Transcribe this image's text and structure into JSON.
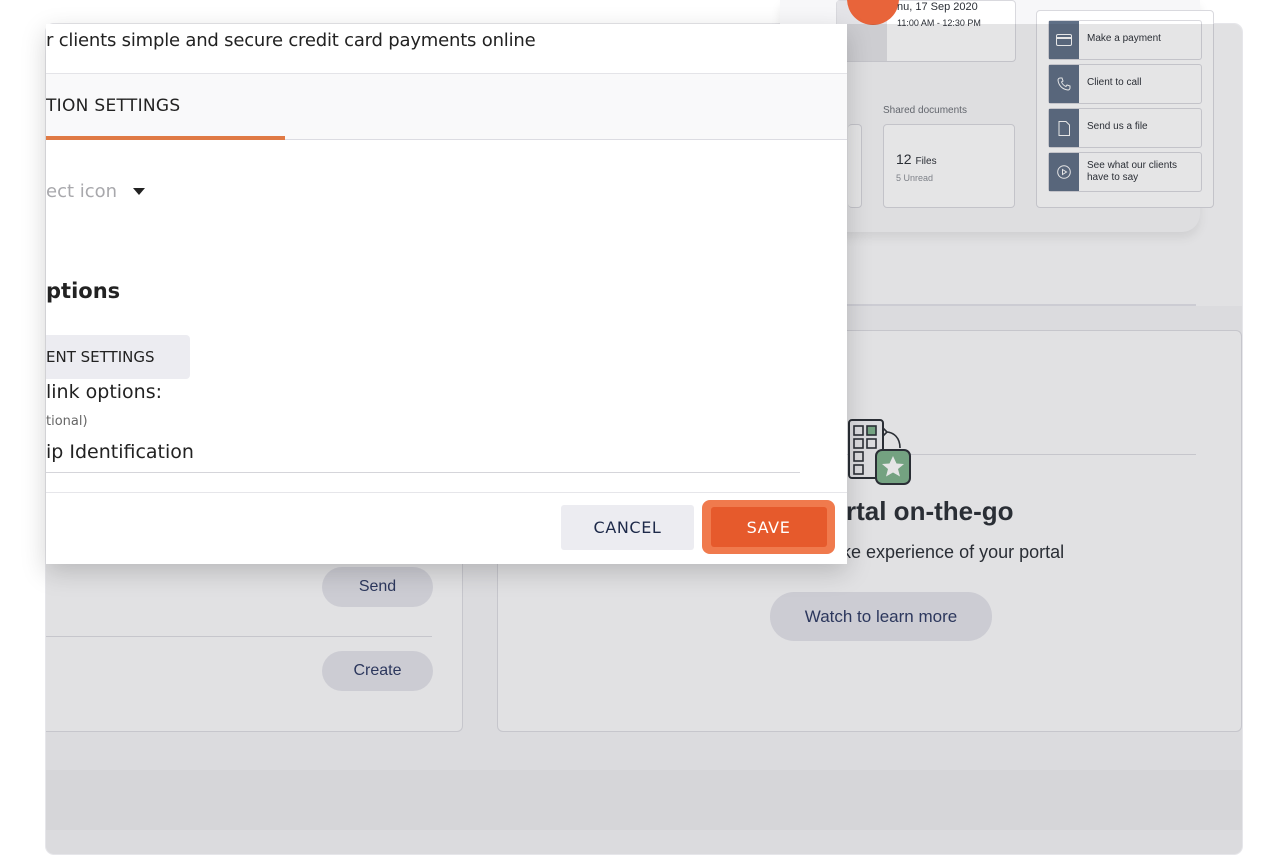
{
  "background": {
    "appointment": {
      "date": "nu, 17 Sep 2020",
      "time": "11:00 AM - 12:30 PM"
    },
    "shared_documents": {
      "label": "Shared documents",
      "count": "12",
      "unit": "Files",
      "unread": "5 Unread"
    },
    "actions": [
      {
        "label": "Make a payment",
        "icon": "credit-card-icon"
      },
      {
        "label": "Client to call",
        "icon": "phone-icon"
      },
      {
        "label": "Send us a file",
        "icon": "file-icon"
      },
      {
        "label": "See what our clients have to say",
        "icon": "play-icon"
      }
    ],
    "send_button": "Send",
    "create_button": "Create",
    "portal": {
      "title": "rtal on-the-go",
      "subtitle": "p-like experience of your portal",
      "watch_button": "Watch to learn more"
    }
  },
  "modal": {
    "description": "r clients simple and secure credit card payments online",
    "tab_label": "TION SETTINGS",
    "icon_select_placeholder": "ect icon",
    "options_heading": "ptions",
    "payment_settings_button": "ENT SETTINGS",
    "link_options_label": "link options:",
    "optional_hint": "tional)",
    "identification_value": "ip Identification",
    "cancel_button": "CANCEL",
    "save_button": "SAVE"
  },
  "colors": {
    "accent": "#e65a2c",
    "tab_underline": "#e07a45",
    "button_text_navy": "#1e2a4a"
  }
}
